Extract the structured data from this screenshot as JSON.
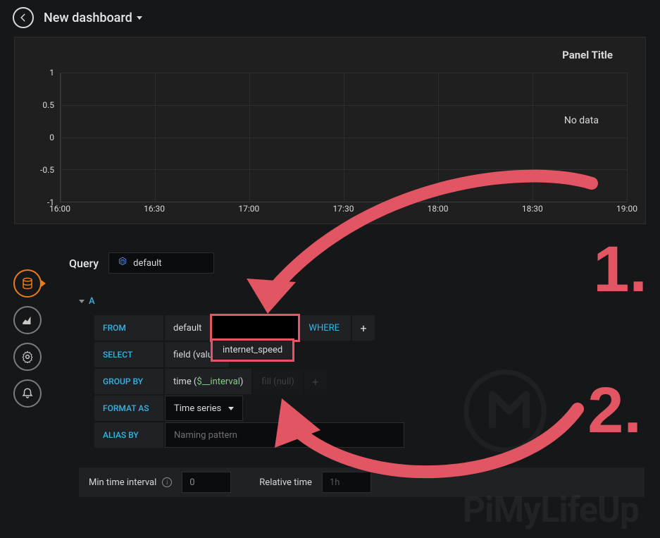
{
  "header": {
    "title": "New dashboard"
  },
  "panel": {
    "title": "Panel Title",
    "no_data": "No data"
  },
  "chart_data": {
    "type": "line",
    "title": "Panel Title",
    "xlabel": "",
    "ylabel": "",
    "x_ticks": [
      "16:00",
      "16:30",
      "17:00",
      "17:30",
      "18:00",
      "18:30",
      "19:00"
    ],
    "y_ticks": [
      -1.0,
      -0.5,
      0,
      0.5,
      1.0
    ],
    "ylim": [
      -1.0,
      1.0
    ],
    "series": [],
    "note": "No data"
  },
  "editor": {
    "section_title": "Query",
    "datasource": "default",
    "query_letter": "A",
    "rows": {
      "from": {
        "label": "FROM",
        "policy": "default",
        "measurement": "",
        "where_label": "WHERE"
      },
      "select": {
        "label": "SELECT",
        "field": "field (value)"
      },
      "group_by": {
        "label": "GROUP BY",
        "time": "time ($__interval)",
        "time_prefix": "time (",
        "time_value": "$__interval",
        "time_suffix": ")",
        "fill": "fill (null)"
      },
      "format_as": {
        "label": "FORMAT AS",
        "value": "Time series"
      },
      "alias_by": {
        "label": "ALIAS BY",
        "placeholder": "Naming pattern"
      }
    },
    "suggestion": "internet_speed",
    "options": {
      "min_interval_label": "Min time interval",
      "min_interval_value": "0",
      "relative_time_label": "Relative time",
      "relative_time_value": "1h"
    }
  },
  "annotations": {
    "n1": "1.",
    "n2": "2."
  },
  "watermark": "PiMyLifeUp"
}
